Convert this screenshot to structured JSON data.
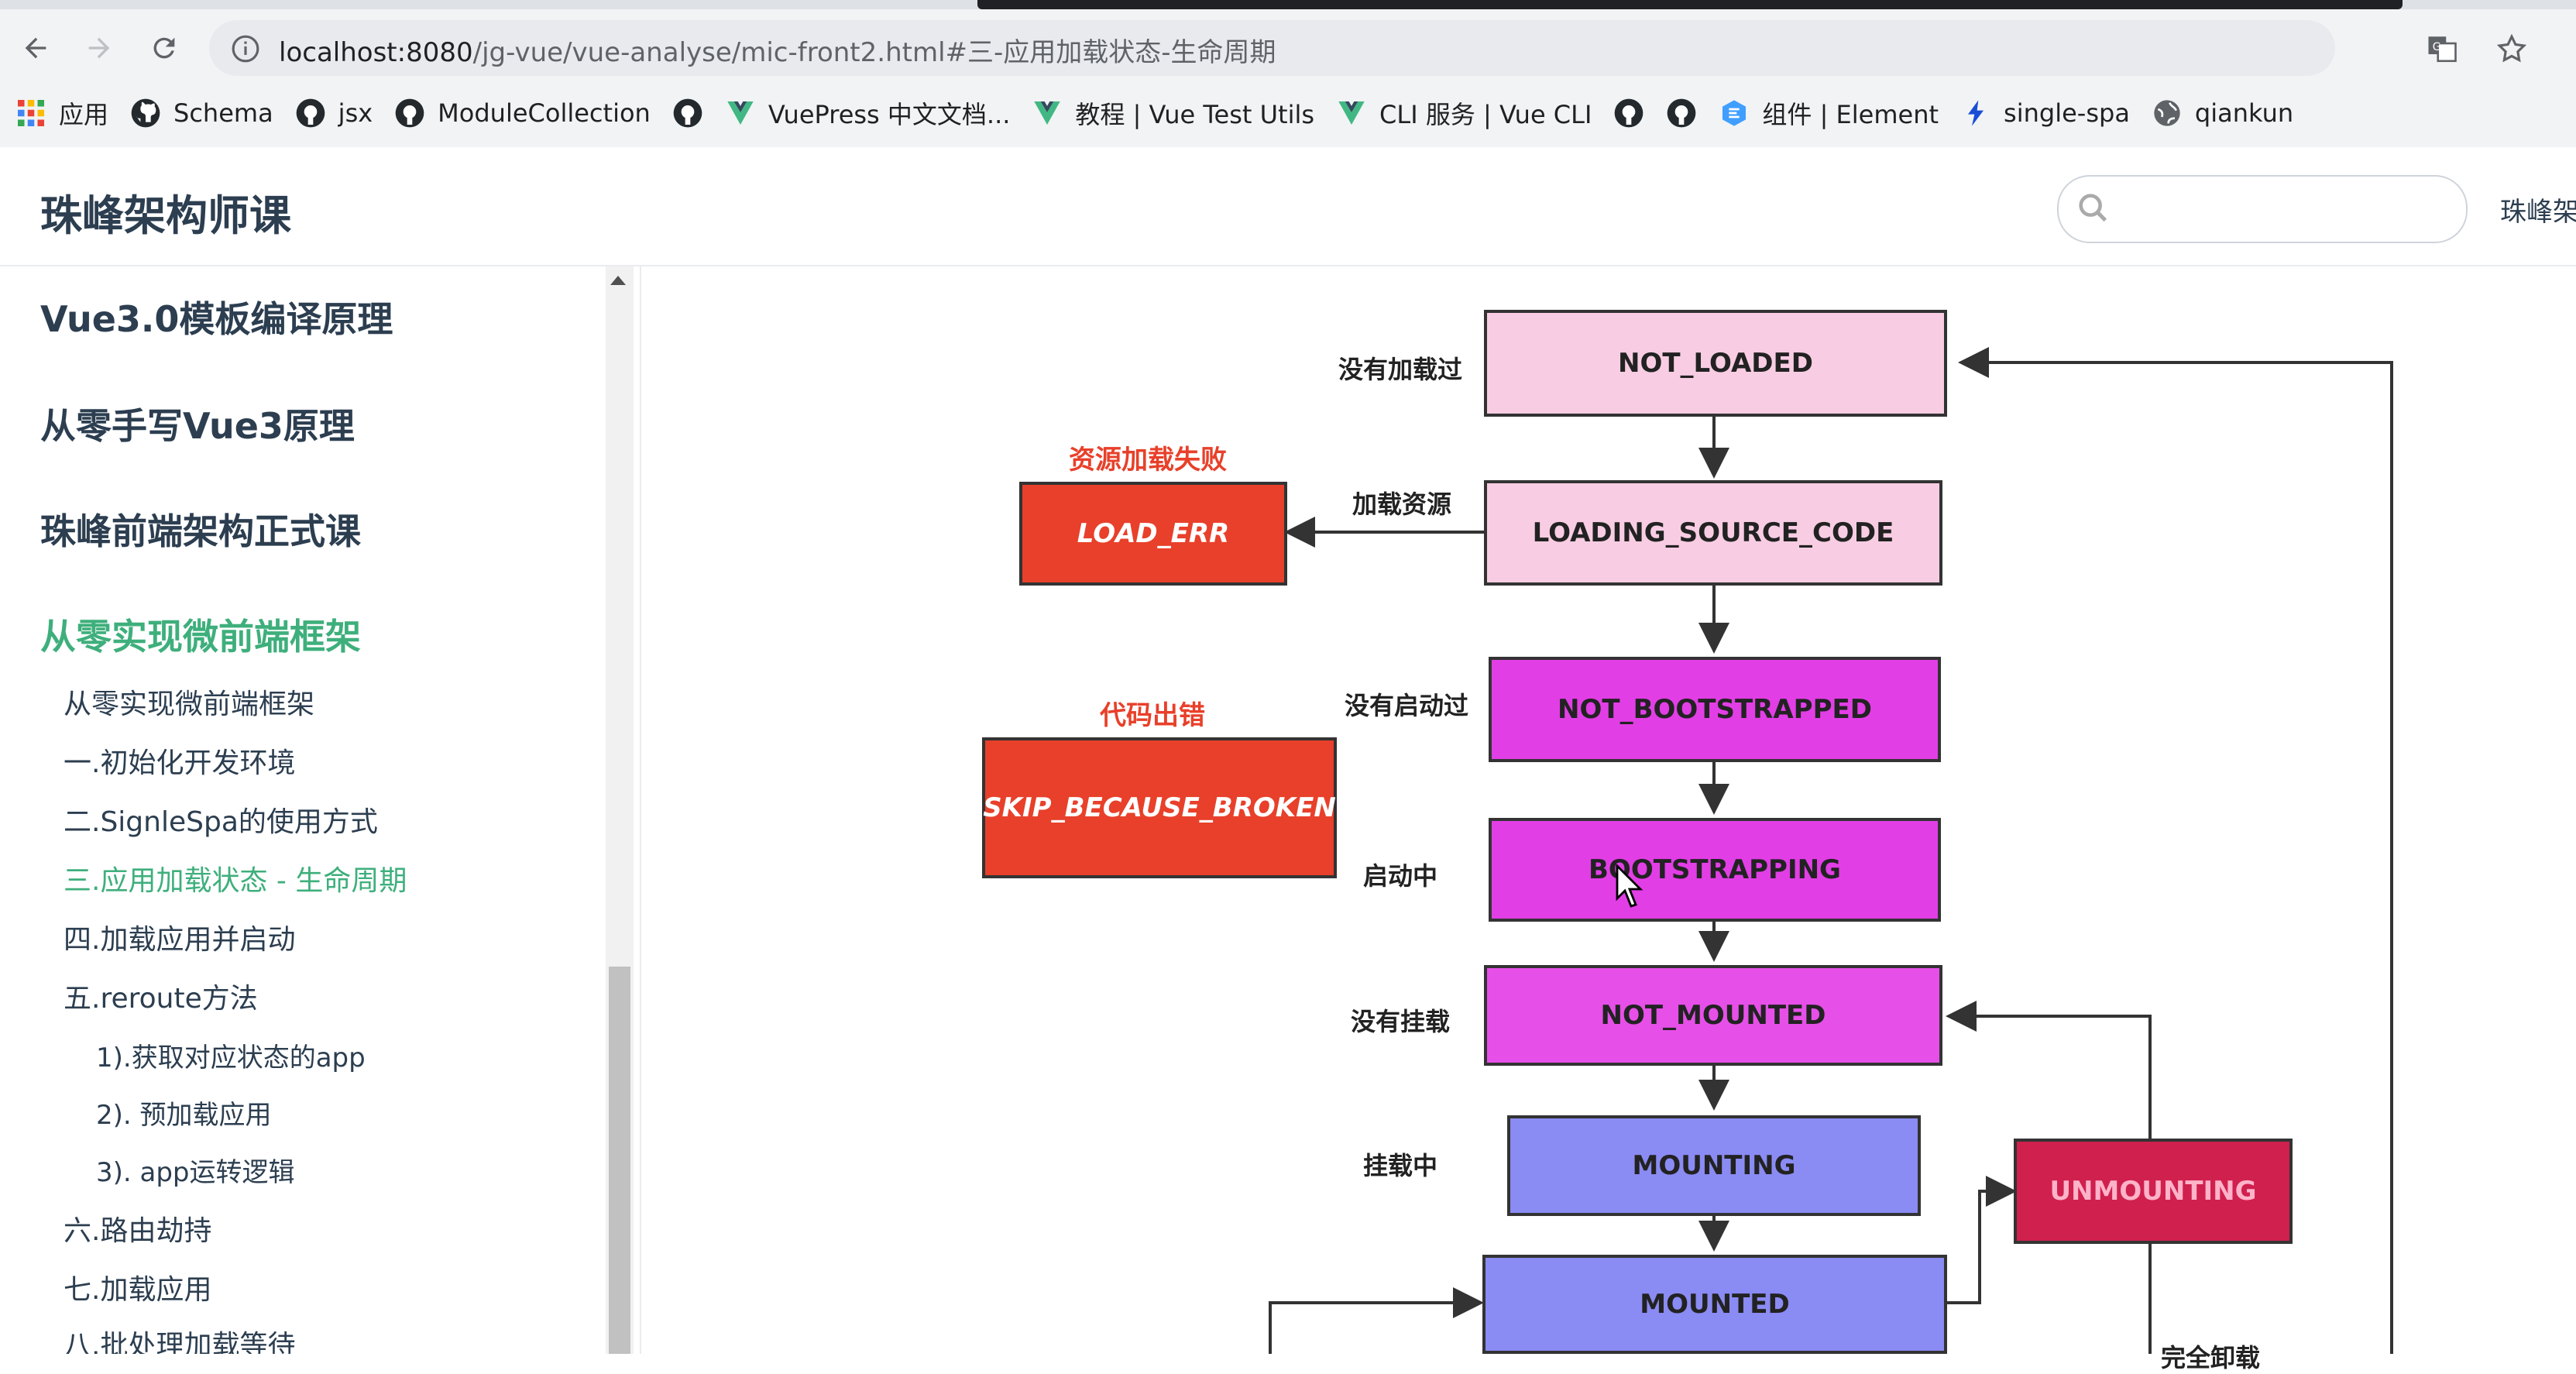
{
  "browser": {
    "url_host": "localhost:8080",
    "url_path": "/jg-vue/vue-analyse/mic-front2.html#三-应用加载状态-生命周期",
    "bookmarks": [
      {
        "label": "应用",
        "icon": "apps-grid-icon"
      },
      {
        "label": "Schema",
        "icon": "github-icon"
      },
      {
        "label": "jsx",
        "icon": "github-icon"
      },
      {
        "label": "ModuleCollection",
        "icon": "github-icon"
      },
      {
        "label": "",
        "icon": "github-icon"
      },
      {
        "label": "VuePress 中文文档...",
        "icon": "vue-icon"
      },
      {
        "label": "教程 | Vue Test Utils",
        "icon": "vue-icon"
      },
      {
        "label": "CLI 服务 | Vue CLI",
        "icon": "vue-icon"
      },
      {
        "label": "",
        "icon": "github-icon"
      },
      {
        "label": "",
        "icon": "github-icon"
      },
      {
        "label": "组件 | Element",
        "icon": "element-icon"
      },
      {
        "label": "single-spa",
        "icon": "single-spa-icon"
      },
      {
        "label": "qiankun",
        "icon": "globe-icon"
      }
    ]
  },
  "site": {
    "title": "珠峰架构师课",
    "search_placeholder": "",
    "nav_text": "珠峰架"
  },
  "sidebar": {
    "groups": [
      {
        "label": "Vue3.0模板编译原理"
      },
      {
        "label": "从零手写Vue3原理"
      },
      {
        "label": "珠峰前端架构正式课"
      },
      {
        "label": "从零实现微前端框架"
      }
    ],
    "items": [
      {
        "label": "从零实现微前端框架"
      },
      {
        "label": "一.初始化开发环境"
      },
      {
        "label": "二.SignleSpa的使用方式"
      },
      {
        "label": "三.应用加载状态 - 生命周期"
      },
      {
        "label": "四.加载应用并启动"
      },
      {
        "label": "五.reroute方法"
      },
      {
        "label": "1).获取对应状态的app"
      },
      {
        "label": "2). 预加载应用"
      },
      {
        "label": "3). app运转逻辑"
      },
      {
        "label": "六.路由劫持"
      },
      {
        "label": "七.加载应用"
      },
      {
        "label": "八.批处理加载等待"
      }
    ]
  },
  "diagram": {
    "states": {
      "not_loaded": "NOT_LOADED",
      "loading_source_code": "LOADING_SOURCE_CODE",
      "load_err": "LOAD_ERR",
      "not_bootstrapped": "NOT_BOOTSTRAPPED",
      "skip_because_broken": "SKIP_BECAUSE_BROKEN",
      "bootstrapping": "BOOTSTRAPPING",
      "not_mounted": "NOT_MOUNTED",
      "mounting": "MOUNTING",
      "unmounting": "UNMOUNTING",
      "mounted": "MOUNTED"
    },
    "labels": {
      "not_loaded": "没有加载过",
      "loading": "加载资源",
      "load_err": "资源加载失败",
      "not_bootstrapped": "没有启动过",
      "broken": "代码出错",
      "bootstrapping": "启动中",
      "not_mounted": "没有挂载",
      "mounting": "挂载中",
      "unmount_partial": "完全卸载"
    },
    "colors": {
      "light_pink": "#f8cde3",
      "magenta": "#e23ee6",
      "magenta_light": "#e650e8",
      "periwinkle": "#8a8bf3",
      "crimson": "#d0204e",
      "error_red": "#e8402a"
    }
  }
}
